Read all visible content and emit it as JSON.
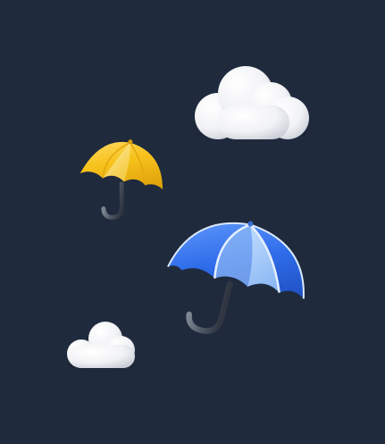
{
  "scene": {
    "background_color": "#1f2a3d",
    "objects": [
      {
        "name": "cloud-large",
        "kind": "cloud",
        "color": "#f4f5f7"
      },
      {
        "name": "cloud-small",
        "kind": "cloud",
        "color": "#f4f5f7"
      },
      {
        "name": "umbrella-yellow",
        "kind": "umbrella",
        "canopy_color": "#f7c21b",
        "handle_color": "#5b6472"
      },
      {
        "name": "umbrella-blue",
        "kind": "umbrella",
        "canopy_color": "#3f7df0",
        "handle_color": "#5b6472"
      }
    ]
  }
}
